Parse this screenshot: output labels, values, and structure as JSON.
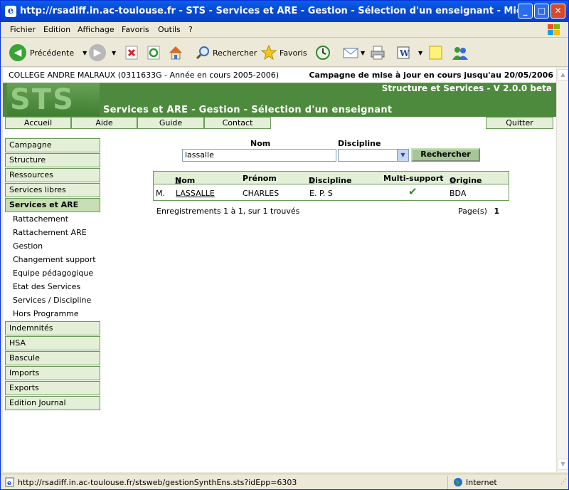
{
  "window": {
    "title": "http://rsadiff.in.ac-toulouse.fr - STS - Services et ARE - Gestion - Sélection d'un enseignant - Microsoft Interne..."
  },
  "menu": [
    "Fichier",
    "Edition",
    "Affichage",
    "Favoris",
    "Outils",
    "?"
  ],
  "toolbar": {
    "back_label": "Précédente",
    "search_label": "Rechercher",
    "favorites_label": "Favoris"
  },
  "header": {
    "school": "COLLEGE ANDRE MALRAUX (0311633G - Année en cours 2005-2006)",
    "campaign": "Campagne de mise à jour en cours jusqu'au 20/05/2006",
    "logo": "STS",
    "version": "Structure et Services - V 2.0.0 beta",
    "page_title": "Services et ARE - Gestion - Sélection d'un enseignant"
  },
  "tabs": [
    "Accueil",
    "Aide",
    "Guide",
    "Contact"
  ],
  "quit_label": "Quitter",
  "sidebar": {
    "items_top": [
      "Campagne",
      "Structure",
      "Ressources",
      "Services libres"
    ],
    "active": "Services et ARE",
    "subitems": [
      "Rattachement",
      "Rattachement ARE",
      "Gestion",
      "Changement support",
      "Equipe pédagogique",
      "Etat des Services",
      "Services / Discipline",
      "Hors Programme"
    ],
    "items_bottom": [
      "Indemnités",
      "HSA",
      "Bascule",
      "Imports",
      "Exports",
      "Edition Journal"
    ]
  },
  "search": {
    "nom_label": "Nom",
    "discipline_label": "Discipline",
    "nom_value": "lassalle",
    "discipline_value": "",
    "button_label": "Rechercher"
  },
  "results": {
    "columns": {
      "nom": "Nom",
      "prenom": "Prénom",
      "discipline": "Discipline",
      "multi_support": "Multi-support",
      "origine": "Origine"
    },
    "rows": [
      {
        "civilite": "M.",
        "nom": "LASSALLE",
        "prenom": "CHARLES",
        "discipline": "E. P. S",
        "multi_support": "✔",
        "origine": "BDA"
      }
    ],
    "summary": "Enregistrements 1 à 1, sur 1 trouvés",
    "pages_label": "Page(s)",
    "page": "1"
  },
  "status": {
    "url": "http://rsadiff.in.ac-toulouse.fr/stsweb/gestionSynthEns.sts?idEpp=6303",
    "zone": "Internet"
  },
  "colors": {
    "accent": "#4e8a3e",
    "tab_bg": "#e3efd6",
    "border": "#6b9a5b"
  }
}
